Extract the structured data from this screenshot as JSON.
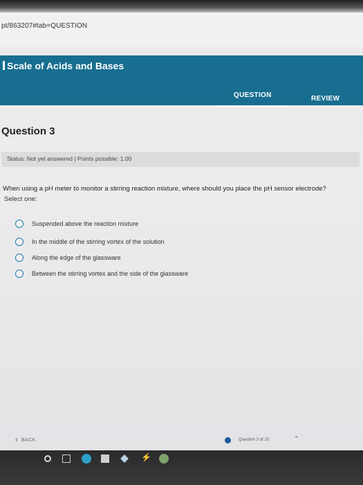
{
  "browser": {
    "url": "pt/863207#tab=QUESTION"
  },
  "app": {
    "title": "Scale of Acids and Bases",
    "tabs": [
      {
        "label": "QUESTION",
        "active": true
      },
      {
        "label": "REVIEW",
        "active": false
      }
    ]
  },
  "question": {
    "heading": "Question 3",
    "status": "Status: Not yet answered | Points possible: 1.00",
    "prompt": "When using a pH meter to monitor a stirring reaction mixture, where should you place the pH sensor electrode?",
    "select_label": "Select one:",
    "options": [
      "Suspended above the reaction mixture",
      "In the middle of the stirring vortex of the solution",
      "Along the edge of the glassware",
      "Between the stirring vortex and the side of the glassware"
    ]
  },
  "footer": {
    "back_label": "BACK",
    "progress_text": "Question 3 of 10"
  },
  "colors": {
    "header": "#176e90",
    "radio": "#1a7aa5",
    "progress_dot": "#1b5c9c"
  }
}
